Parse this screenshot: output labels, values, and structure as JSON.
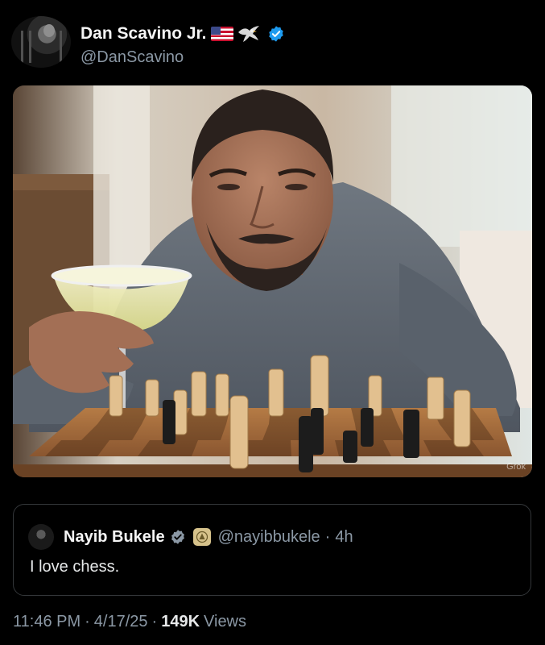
{
  "author": {
    "name": "Dan Scavino Jr.",
    "handle": "@DanScavino",
    "name_emojis": [
      "us-flag-icon",
      "eagle-icon"
    ],
    "verified": true
  },
  "media": {
    "watermark": "Grok",
    "alt_icon": "photo"
  },
  "quoted_tweet": {
    "author_name": "Nayib Bukele",
    "handle": "@nayibbukele",
    "separator": "·",
    "time_ago": "4h",
    "text": "I love chess.",
    "verified": true,
    "affiliation_badge": "government-seal-icon"
  },
  "meta": {
    "time": "11:46 PM",
    "date": "4/17/25",
    "separator": "·",
    "views_count": "149K",
    "views_label": "Views"
  },
  "colors": {
    "background": "#000000",
    "primary_text": "#e7e9ea",
    "secondary_text": "#8b98a5",
    "verified_blue": "#1d9bf0",
    "border": "#333639"
  }
}
